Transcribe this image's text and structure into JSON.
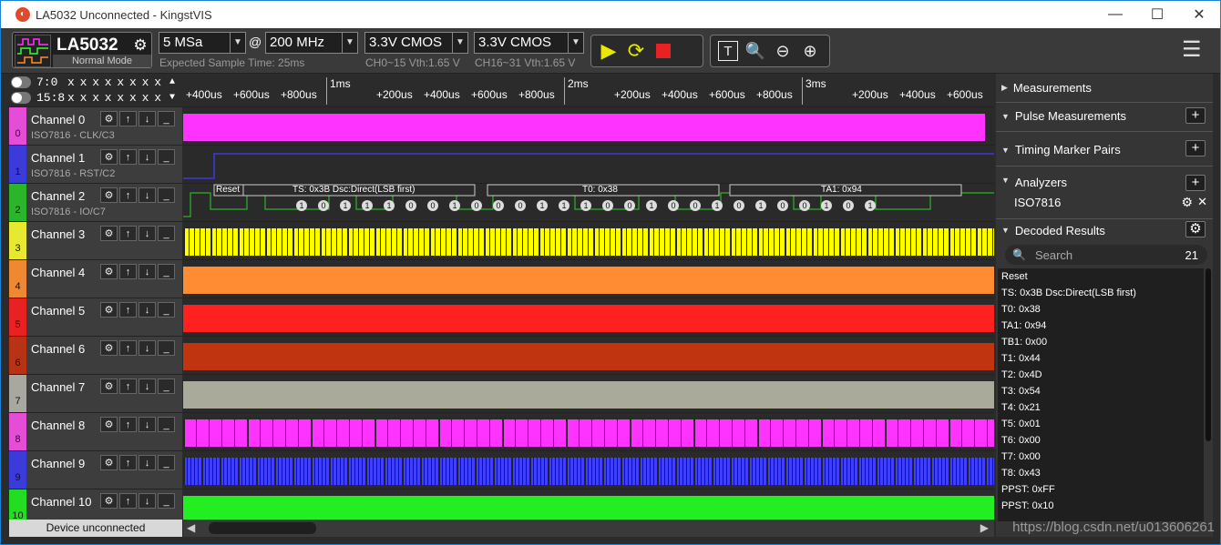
{
  "window": {
    "title": "LA5032 Unconnected - KingstVIS",
    "icon": "kingst-icon"
  },
  "toolbar": {
    "device_name": "LA5032",
    "device_mode": "Normal Mode",
    "sample_depth": "5 MSa",
    "at": "@",
    "sample_rate": "200 MHz",
    "expected_time": "Expected Sample Time: 25ms",
    "vth1_select": "3.3V CMOS",
    "vth1_info": "CH0~15 Vth:1.65 V",
    "vth2_select": "3.3V CMOS",
    "vth2_info": "CH16~31 Vth:1.65 V"
  },
  "channel_header": {
    "row1_label": "7:0",
    "row1_values": "x x x x x x x x",
    "row2_label": "15:8",
    "row2_values": "x x x x x x x x"
  },
  "channels": [
    {
      "num": "0",
      "name": "Channel 0",
      "sub": "ISO7816 - CLK/C3",
      "color": "#e64dd6",
      "wave": "#ff33ff"
    },
    {
      "num": "1",
      "name": "Channel 1",
      "sub": "ISO7816 - RST/C2",
      "color": "#3b3bd9",
      "wave": "#3b3bd9"
    },
    {
      "num": "2",
      "name": "Channel 2",
      "sub": "ISO7816 - IO/C7",
      "color": "#2bb52b",
      "wave": "#2bb52b"
    },
    {
      "num": "3",
      "name": "Channel 3",
      "sub": "",
      "color": "#e8e830",
      "wave": "#ffff00"
    },
    {
      "num": "4",
      "name": "Channel 4",
      "sub": "",
      "color": "#ee8833",
      "wave": "#ff8c33"
    },
    {
      "num": "5",
      "name": "Channel 5",
      "sub": "",
      "color": "#e82222",
      "wave": "#ff2020"
    },
    {
      "num": "6",
      "name": "Channel 6",
      "sub": "",
      "color": "#b83315",
      "wave": "#c03510"
    },
    {
      "num": "7",
      "name": "Channel 7",
      "sub": "",
      "color": "#a8a8a0",
      "wave": "#aaaa9a"
    },
    {
      "num": "8",
      "name": "Channel 8",
      "sub": "",
      "color": "#e64dd6",
      "wave": "#ff33ff"
    },
    {
      "num": "9",
      "name": "Channel 9",
      "sub": "",
      "color": "#3b3bd9",
      "wave": "#3f3fff"
    },
    {
      "num": "10",
      "name": "Channel 10",
      "sub": "",
      "color": "#22dd22",
      "wave": "#22ee22"
    }
  ],
  "device_status": "Device unconnected",
  "timeline": {
    "ticks": [
      "+400us",
      "+600us",
      "+800us",
      "+200us",
      "+400us",
      "+600us",
      "+800us",
      "+200us",
      "+400us",
      "+600us",
      "+800us",
      "+200us",
      "+400us",
      "+600us"
    ],
    "majors": [
      "1ms",
      "2ms",
      "3ms"
    ]
  },
  "decode_labels": {
    "reset": "Reset",
    "ts": "TS: 0x3B Dsc:Direct(LSB first)",
    "t0": "T0: 0x38",
    "ta1": "TA1: 0x94"
  },
  "bits": [
    "1",
    "0",
    "1",
    "1",
    "1",
    "0",
    "0",
    "1",
    "0",
    "0",
    "0",
    "1",
    "1",
    "1",
    "0",
    "0",
    "1",
    "0",
    "0",
    "1",
    "0",
    "1",
    "0",
    "0",
    "1",
    "0",
    "1"
  ],
  "right_panel": {
    "measurements": "Measurements",
    "pulse": "Pulse Measurements",
    "timing": "Timing Marker Pairs",
    "analyzers": "Analyzers",
    "analyzer_item": "ISO7816",
    "decoded": "Decoded Results",
    "search_placeholder": "Search",
    "result_count": "21",
    "results": [
      "Reset",
      "TS: 0x3B Dsc:Direct(LSB first)",
      "T0: 0x38",
      "TA1: 0x94",
      "TB1: 0x00",
      "T1: 0x44",
      "T2: 0x4D",
      "T3: 0x54",
      "T4: 0x21",
      "T5: 0x01",
      "T6: 0x00",
      "T7: 0x00",
      "T8: 0x43",
      "PPST: 0xFF",
      "PPST: 0x10"
    ]
  },
  "watermark": "https://blog.csdn.net/u013606261"
}
